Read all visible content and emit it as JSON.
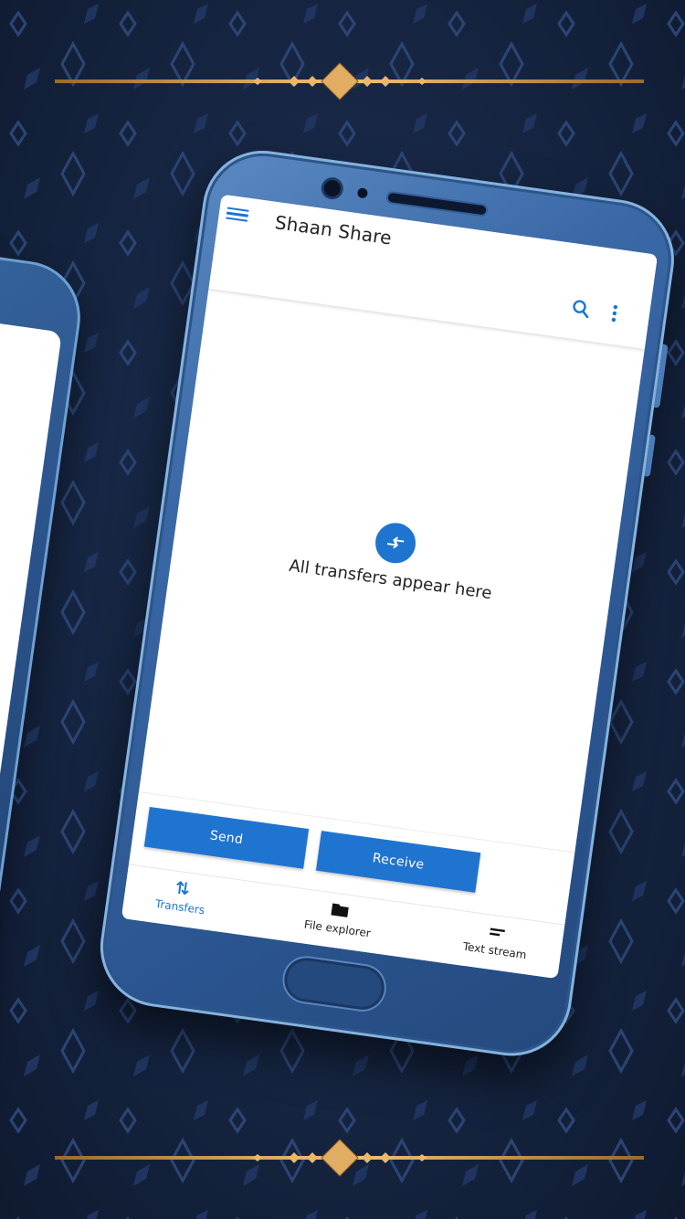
{
  "app": {
    "title": "Shaan Share"
  },
  "empty_state": {
    "message": "All transfers appear here"
  },
  "actions": {
    "send_label": "Send",
    "receive_label": "Receive"
  },
  "bottom_nav": {
    "items": [
      {
        "label": "Transfers",
        "icon": "transfer-arrows-icon",
        "active": true
      },
      {
        "label": "File explorer",
        "icon": "folder-icon",
        "active": false
      },
      {
        "label": "Text stream",
        "icon": "text-lines-icon",
        "active": false
      }
    ]
  },
  "colors": {
    "accent": "#1976d2",
    "button": "#1f74d0",
    "background": "#172745",
    "phone_body": "#3a68a6",
    "ornament_gold": "#d9a55a"
  }
}
